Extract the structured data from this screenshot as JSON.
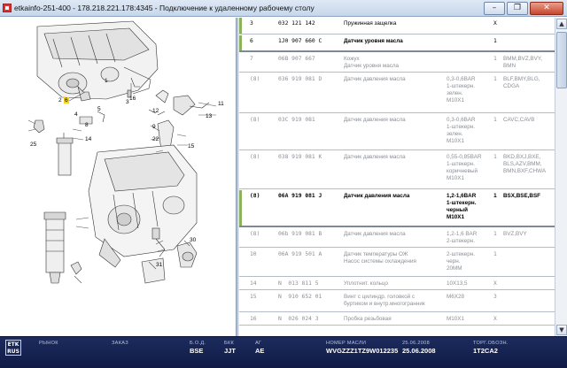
{
  "window": {
    "title": "etkainfo-251-400 - 178.218.221.178:4345 - Подключение к удаленному рабочему столу",
    "minimize_glyph": "–",
    "maximize_glyph": "❐",
    "close_glyph": "✕"
  },
  "diagram": {
    "callouts": [
      "1",
      "2",
      "3",
      "4",
      "5",
      "6",
      "8",
      "9",
      "11",
      "12",
      "13",
      "14",
      "15",
      "16",
      "22",
      "25",
      "30",
      "31"
    ]
  },
  "parts_table": {
    "rows": [
      {
        "pos": "3",
        "number": "032 121 142",
        "name": "Пружинная защелка",
        "note": "",
        "qty": "X",
        "models": "",
        "state": "bright"
      },
      {
        "pos": "6",
        "number": "1J0 907 660 C",
        "name": "Датчик уровня масла",
        "note": "",
        "qty": "1",
        "models": "",
        "state": "bright"
      },
      {
        "pos": "7",
        "number": "06B 907 667",
        "name": "Кожух\nДатчик уровня масла",
        "note": "",
        "qty": "1",
        "models": "BMM,BVZ,BVY,\nBMN",
        "state": "dim"
      },
      {
        "pos": "(8)",
        "number": "036 919 081 D",
        "name": "Датчик давления масла",
        "note": "0,3-0,6BAR\n1-штекерн.\nзелен.\nM10X1",
        "qty": "1",
        "models": "BLF,BMY,BLG,\nCDGA",
        "state": "dim"
      },
      {
        "pos": "(8)",
        "number": "03C 919 081",
        "name": "Датчик давления масла",
        "note": "0,3-0,6BAR\n1-штекерн.\nзелен.\nM10X1",
        "qty": "1",
        "models": "CAVC,CAVB",
        "state": "dim"
      },
      {
        "pos": "(8)",
        "number": "038 919 081 K",
        "name": "Датчик давления масла",
        "note": "0,55-0,85BAR\n1-штекерн.\nкоричневый\nM10X1",
        "qty": "1",
        "models": "BKD,BXJ,BXE,\nBLS,AZV,BMM,\nBMN,BXF,CHWA",
        "state": "dim"
      },
      {
        "pos": "(8)",
        "number": "06A 919 081 J",
        "name": "Датчик давления масла",
        "note": "1,2-1,6BAR\n1-штекерн.\nчерный\nM10X1",
        "qty": "1",
        "models": "BSX,BSE,BSF",
        "state": "active"
      },
      {
        "pos": "(8)",
        "number": "06b 919 081 B",
        "name": "Датчик давления масла",
        "note": "1,2-1,6 BAR\n2-штекерн.",
        "qty": "1",
        "models": "BVZ,BVY",
        "state": "dim"
      },
      {
        "pos": "10",
        "number": "06A 919 501 A",
        "name": "Датчик температуры ОЖ\nНасос системы охлаждения",
        "note": "2-штекерн.\nчерн.\n20MM",
        "qty": "1",
        "models": "",
        "state": "dim"
      },
      {
        "pos": "14",
        "number": "N  013 811 5",
        "name": "Уплотнит. кольцо",
        "note": "10X13,5",
        "qty": "X",
        "models": "",
        "state": "dim"
      },
      {
        "pos": "15",
        "number": "N  910 652 01",
        "name": "Винт с цилиндр. головкой с\nбуртиком и внутр.многогранник",
        "note": "M6X28",
        "qty": "3",
        "models": "",
        "state": "dim"
      },
      {
        "pos": "16",
        "number": "N  026 024 3",
        "name": "Пробка резьбовая",
        "note": "M10X1",
        "qty": "X",
        "models": "",
        "state": "dim"
      }
    ]
  },
  "scrollbar": {
    "up_glyph": "▲",
    "down_glyph": "▼"
  },
  "statusbar": {
    "logo": "ETK\nRUS",
    "fields": [
      {
        "label": "РЫНОК",
        "value": ""
      },
      {
        "label": "ЗАКАЗ",
        "value": ""
      },
      {
        "label": "Б.О.Д.",
        "value": "BSE"
      },
      {
        "label": "БКК",
        "value": "JJT"
      },
      {
        "label": "АГ",
        "value": "AE"
      },
      {
        "label": "НОМЕР МАСЛИ",
        "value": "WVGZZZ1TZ9W012235"
      },
      {
        "label": "25.06.2008",
        "value": "25.06.2008"
      },
      {
        "label": "ТОРГ.ОБОЗН.",
        "value": "1T2CA2"
      }
    ]
  },
  "colors": {
    "accent_bar": "#8db05a",
    "status_bg": "#142254",
    "highlight": "#f7d21c"
  }
}
